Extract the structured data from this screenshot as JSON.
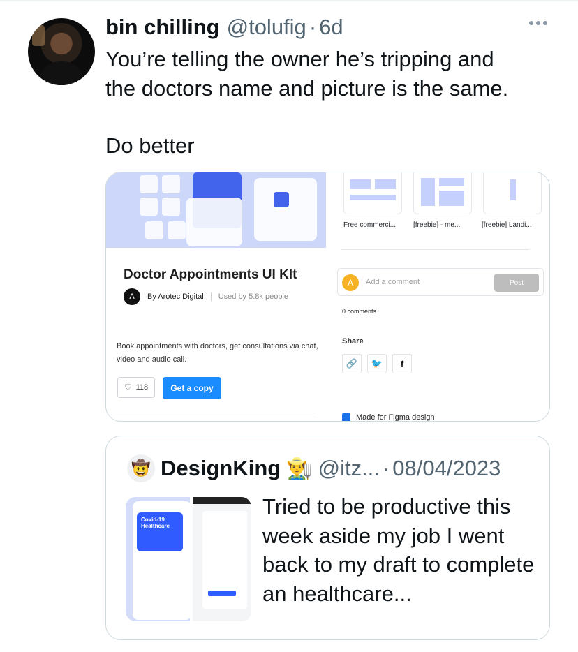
{
  "tweet": {
    "name": "bin chilling",
    "handle": "@tolufig",
    "separator": "·",
    "time": "6d",
    "text_line1": "You’re telling the owner he’s tripping and",
    "text_line2": "the doctors name and picture is the same.",
    "text_line3": "Do better",
    "more_icon": "more-horizontal-icon"
  },
  "media": {
    "title": "Doctor Appointments UI KIt",
    "author_logo": "A",
    "author": "By Arotec Digital",
    "used_by": "Used by 5.8k people",
    "description": "Book appointments with doctors, get consultations via chat, video and audio call.",
    "likes": "118",
    "get_copy": "Get a copy",
    "thumbnails": [
      "Free commerci...",
      "[freebie] - me...",
      "[freebie] Landi..."
    ],
    "comment_avatar": "A",
    "comment_placeholder": "Add a comment",
    "post_label": "Post",
    "comments_count": "0 comments",
    "share_label": "Share",
    "share_twitter": "🐦",
    "share_facebook": "f",
    "made_for": "Made for Figma design",
    "hero_accent": "#4263eb",
    "button_blue": "#1a8cff"
  },
  "quote": {
    "avatar_emoji": "🤠",
    "name": "DesignKing",
    "badge_emoji": "👨‍🌾",
    "handle": "@itz...",
    "separator": "·",
    "date": "08/04/2023",
    "text": "Tried to be productive this week aside my job I went back to my draft to complete an healthcare...",
    "thumb_title": "Covid-19 Healthcare"
  }
}
